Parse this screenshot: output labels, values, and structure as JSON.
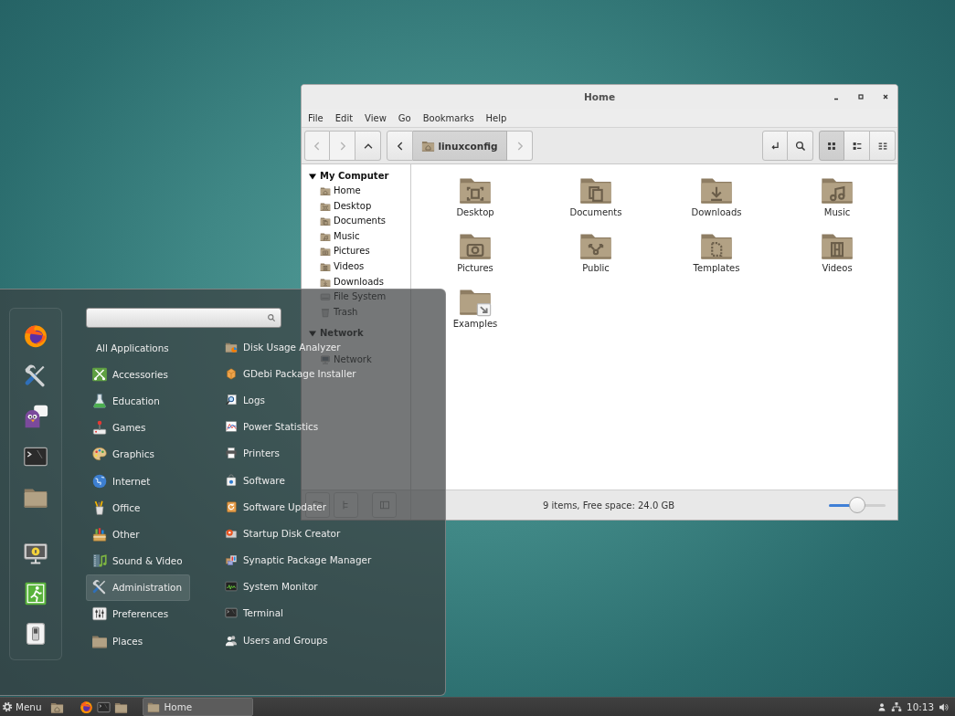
{
  "file_manager": {
    "title": "Home",
    "menu": [
      "File",
      "Edit",
      "View",
      "Go",
      "Bookmarks",
      "Help"
    ],
    "nav_buttons": [
      {
        "kind": "back",
        "disabled": true
      },
      {
        "kind": "forward",
        "disabled": true
      },
      {
        "kind": "up",
        "disabled": false
      }
    ],
    "path_bar": {
      "back": {
        "disabled": false
      },
      "crumbs": [
        {
          "label": "linuxconfig",
          "selected": true
        }
      ],
      "forward": {
        "disabled": true
      }
    },
    "view_buttons": [
      {
        "kind": "icons",
        "selected": true
      },
      {
        "kind": "list",
        "selected": false
      },
      {
        "kind": "compact",
        "selected": false
      }
    ],
    "sidebar": [
      {
        "title": "My Computer",
        "expanded": true,
        "items": [
          {
            "label": "Home",
            "kind": "home"
          },
          {
            "label": "Desktop",
            "kind": "desktop"
          },
          {
            "label": "Documents",
            "kind": "documents"
          },
          {
            "label": "Music",
            "kind": "music"
          },
          {
            "label": "Pictures",
            "kind": "pictures"
          },
          {
            "label": "Videos",
            "kind": "videos"
          },
          {
            "label": "Downloads",
            "kind": "downloads"
          },
          {
            "label": "File System",
            "kind": "drive"
          },
          {
            "label": "Trash",
            "kind": "trash"
          }
        ]
      },
      {
        "title": "Network",
        "expanded": true,
        "items": [
          {
            "label": "Network",
            "kind": "network"
          }
        ]
      }
    ],
    "files": [
      {
        "name": "Desktop",
        "kind": "desktop"
      },
      {
        "name": "Documents",
        "kind": "documents"
      },
      {
        "name": "Downloads",
        "kind": "downloads"
      },
      {
        "name": "Music",
        "kind": "music"
      },
      {
        "name": "Pictures",
        "kind": "pictures"
      },
      {
        "name": "Public",
        "kind": "public"
      },
      {
        "name": "Templates",
        "kind": "templates"
      },
      {
        "name": "Videos",
        "kind": "videos"
      },
      {
        "name": "Examples",
        "kind": "link"
      }
    ],
    "status_bar": {
      "text": "9 items, Free space: 24.0 GB",
      "zoom": {
        "level": 0.5
      }
    }
  },
  "menu": {
    "categories": [
      {
        "label": "All Applications",
        "kind": "all",
        "selected": false
      },
      {
        "label": "Accessories",
        "kind": "accessories",
        "selected": false
      },
      {
        "label": "Education",
        "kind": "education",
        "selected": false
      },
      {
        "label": "Games",
        "kind": "games",
        "selected": false
      },
      {
        "label": "Graphics",
        "kind": "graphics",
        "selected": false
      },
      {
        "label": "Internet",
        "kind": "internet",
        "selected": false
      },
      {
        "label": "Office",
        "kind": "office",
        "selected": false
      },
      {
        "label": "Other",
        "kind": "other",
        "selected": false
      },
      {
        "label": "Sound & Video",
        "kind": "sound-video",
        "selected": false
      },
      {
        "label": "Administration",
        "kind": "administration",
        "selected": true
      },
      {
        "label": "Preferences",
        "kind": "preferences",
        "selected": false
      },
      {
        "label": "Places",
        "kind": "places",
        "selected": false
      }
    ],
    "apps": [
      {
        "label": "Disk Usage Analyzer",
        "kind": "disk-usage"
      },
      {
        "label": "GDebi Package Installer",
        "kind": "package"
      },
      {
        "label": "Logs",
        "kind": "log-viewer"
      },
      {
        "label": "Power Statistics",
        "kind": "power"
      },
      {
        "label": "Printers",
        "kind": "printer"
      },
      {
        "label": "Software",
        "kind": "software"
      },
      {
        "label": "Software Updater",
        "kind": "updater"
      },
      {
        "label": "Startup Disk Creator",
        "kind": "startup-disk"
      },
      {
        "label": "Synaptic Package Manager",
        "kind": "package-manager"
      },
      {
        "label": "System Monitor",
        "kind": "system-monitor"
      },
      {
        "label": "Terminal",
        "kind": "terminal"
      },
      {
        "label": "Users and Groups",
        "kind": "users"
      }
    ]
  },
  "taskbar": {
    "menu_label": "Menu",
    "windows": [
      {
        "label": "Home",
        "selected": true
      }
    ],
    "clock": "10:13"
  }
}
